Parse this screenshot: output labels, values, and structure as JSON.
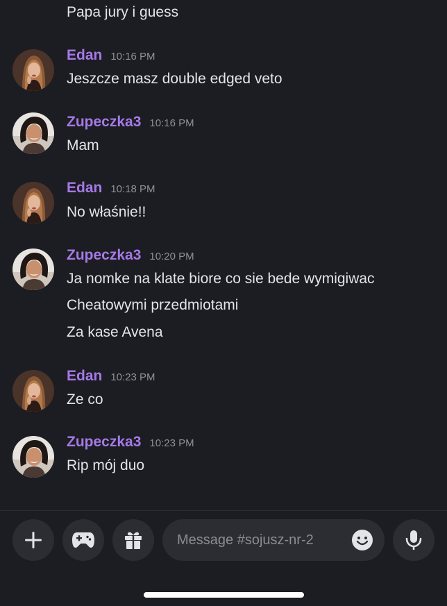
{
  "colors": {
    "background": "#1c1d22",
    "author": "#a679e8",
    "timestamp": "#8f919a",
    "text": "#e3e4e8",
    "button_bg": "#2c2d33"
  },
  "messages": [
    {
      "lines": [
        "Papa jury i guess"
      ]
    },
    {
      "author": "Edan",
      "time": "10:16 PM",
      "lines": [
        "Jeszcze masz double edged veto"
      ]
    },
    {
      "author": "Zupeczka3",
      "time": "10:16 PM",
      "lines": [
        "Mam"
      ]
    },
    {
      "author": "Edan",
      "time": "10:18 PM",
      "lines": [
        "No właśnie!!"
      ]
    },
    {
      "author": "Zupeczka3",
      "time": "10:20 PM",
      "lines": [
        "Ja nomke na klate biore co sie bede wymigiwac",
        "Cheatowymi przedmiotami",
        "Za kase Avena"
      ]
    },
    {
      "author": "Edan",
      "time": "10:23 PM",
      "lines": [
        "Ze co"
      ]
    },
    {
      "author": "Zupeczka3",
      "time": "10:23 PM",
      "lines": [
        "Rip mój duo"
      ]
    }
  ],
  "composer": {
    "placeholder": "Message #sojusz-nr-2",
    "value": "",
    "buttons": {
      "add": "plus-icon",
      "activities": "gamepad-icon",
      "gift": "gift-icon",
      "emoji": "emoji-icon",
      "voice": "microphone-icon"
    }
  }
}
